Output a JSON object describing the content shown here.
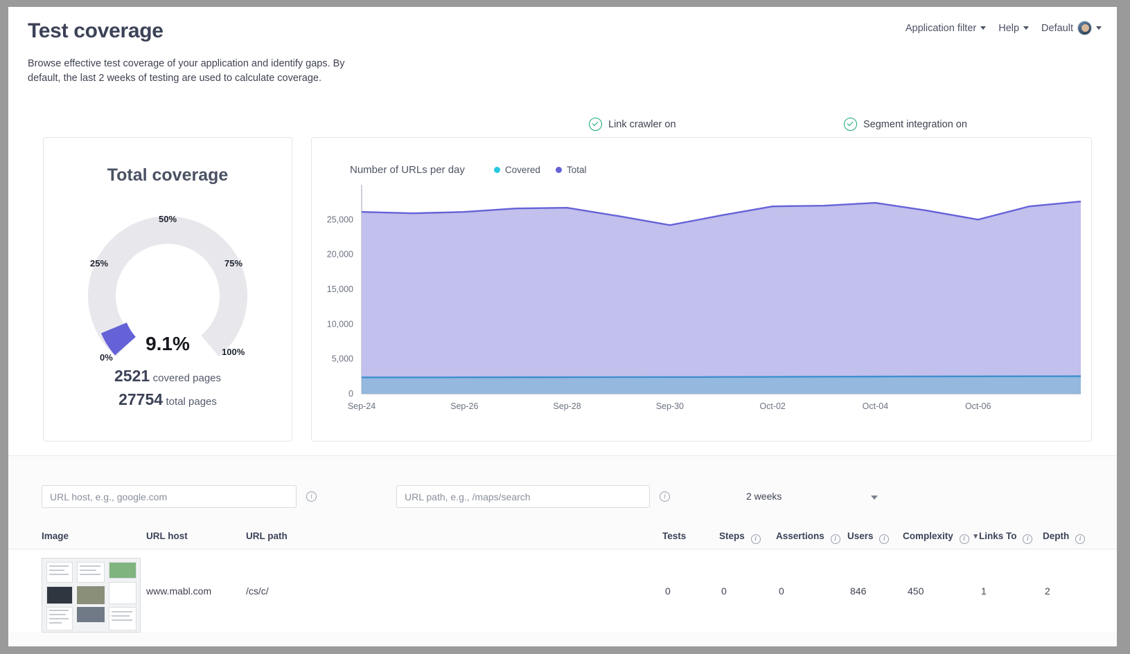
{
  "header": {
    "title": "Test coverage",
    "application_filter": "Application filter",
    "help": "Help",
    "profile": "Default"
  },
  "subtitle": "Browse effective test coverage of your application and identify gaps. By default, the last 2 weeks of testing are used to calculate coverage.",
  "status": {
    "link_crawler": "Link crawler on",
    "segment_integration": "Segment integration on"
  },
  "gauge": {
    "title": "Total coverage",
    "value_label": "9.1%",
    "ticks": [
      "0%",
      "25%",
      "50%",
      "75%",
      "100%"
    ],
    "covered_pages_value": "2521",
    "covered_pages_label": "covered pages",
    "total_pages_value": "27754",
    "total_pages_label": "total pages",
    "arc_color": "#6562d8",
    "track_color": "#e8e8ec"
  },
  "chart_data": {
    "type": "area",
    "title": "Number of URLs per day",
    "xlabel": "",
    "ylabel": "",
    "ylim": [
      0,
      29000
    ],
    "yticks": [
      0,
      5000,
      10000,
      15000,
      20000,
      25000
    ],
    "ytick_labels": [
      "0",
      "5,000",
      "10,000",
      "15,000",
      "20,000",
      "25,000"
    ],
    "x": [
      "Sep-24",
      "Sep-25",
      "Sep-26",
      "Sep-27",
      "Sep-28",
      "Sep-29",
      "Sep-30",
      "Oct-01",
      "Oct-02",
      "Oct-03",
      "Oct-04",
      "Oct-05",
      "Oct-06",
      "Oct-07"
    ],
    "xtick_labels": [
      "Sep-24",
      "Sep-26",
      "Sep-28",
      "Sep-30",
      "Oct-02",
      "Oct-04",
      "Oct-06"
    ],
    "legend": [
      {
        "name": "Covered",
        "color": "#28c8e0"
      },
      {
        "name": "Total",
        "color": "#6562d8"
      }
    ],
    "legend_position": "top",
    "grid": false,
    "series": [
      {
        "name": "Total",
        "color": "#6562d8",
        "fill": "#c2c0ec",
        "values": [
          26100,
          25900,
          26100,
          26600,
          26700,
          25500,
          24200,
          25600,
          26900,
          27000,
          27400,
          26300,
          25000,
          26900,
          27600
        ]
      },
      {
        "name": "Covered",
        "color": "#3f8fd0",
        "fill": "#94b8de",
        "values": [
          2350,
          2350,
          2360,
          2370,
          2380,
          2390,
          2400,
          2410,
          2430,
          2450,
          2470,
          2490,
          2500,
          2510,
          2521
        ]
      }
    ]
  },
  "filters": {
    "url_host_placeholder": "URL host, e.g., google.com",
    "url_path_placeholder": "URL path, e.g., /maps/search",
    "timeframe": "2 weeks"
  },
  "table": {
    "columns": [
      {
        "label": "Image",
        "info": false,
        "sorted": false
      },
      {
        "label": "URL host",
        "info": false,
        "sorted": false
      },
      {
        "label": "URL path",
        "info": false,
        "sorted": false
      },
      {
        "label": "Tests",
        "info": false,
        "sorted": false
      },
      {
        "label": "Steps",
        "info": true,
        "sorted": false
      },
      {
        "label": "Assertions",
        "info": true,
        "sorted": false
      },
      {
        "label": "Users",
        "info": true,
        "sorted": false
      },
      {
        "label": "Complexity",
        "info": true,
        "sorted": true
      },
      {
        "label": "Links To",
        "info": true,
        "sorted": false
      },
      {
        "label": "Depth",
        "info": true,
        "sorted": false
      }
    ],
    "rows": [
      {
        "url_host": "www.mabl.com",
        "url_path": "/cs/c/",
        "tests": "0",
        "steps": "0",
        "assertions": "0",
        "users": "846",
        "complexity": "450",
        "links_to": "1",
        "depth": "2"
      }
    ]
  }
}
